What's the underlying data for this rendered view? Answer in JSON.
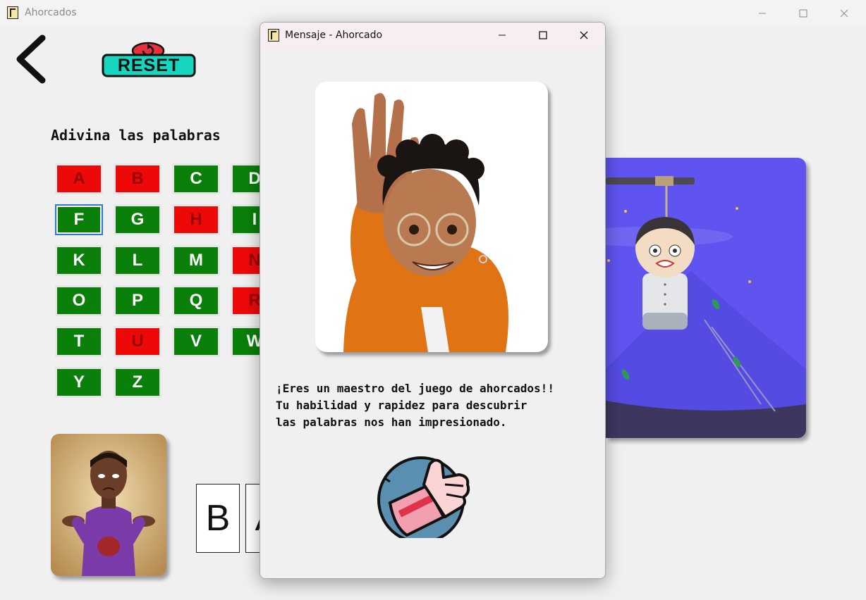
{
  "window": {
    "title": "Ahorcados",
    "icon": "hangman-app-icon",
    "controls": [
      "minimize",
      "maximize",
      "close"
    ]
  },
  "toolbar": {
    "back_icon": "chevron-left-icon",
    "reset_label": "RESET"
  },
  "game": {
    "heading": "Adivina las palabras",
    "letters": [
      {
        "char": "A",
        "status": "wrong"
      },
      {
        "char": "B",
        "status": "wrong"
      },
      {
        "char": "C",
        "status": "correct"
      },
      {
        "char": "D",
        "status": "correct"
      },
      {
        "char": "F",
        "status": "correct",
        "selected": true
      },
      {
        "char": "G",
        "status": "correct"
      },
      {
        "char": "H",
        "status": "wrong"
      },
      {
        "char": "I",
        "status": "correct"
      },
      {
        "char": "K",
        "status": "correct"
      },
      {
        "char": "L",
        "status": "correct"
      },
      {
        "char": "M",
        "status": "correct"
      },
      {
        "char": "N",
        "status": "wrong"
      },
      {
        "char": "O",
        "status": "correct"
      },
      {
        "char": "P",
        "status": "correct"
      },
      {
        "char": "Q",
        "status": "correct"
      },
      {
        "char": "R",
        "status": "wrong"
      },
      {
        "char": "T",
        "status": "correct"
      },
      {
        "char": "U",
        "status": "wrong"
      },
      {
        "char": "V",
        "status": "correct"
      },
      {
        "char": "W",
        "status": "correct"
      },
      {
        "char": "Y",
        "status": "correct"
      },
      {
        "char": "Z",
        "status": "correct"
      }
    ],
    "word_letters": [
      "B",
      "A"
    ]
  },
  "colors": {
    "correct": "#0a7f0a",
    "wrong": "#ee0909",
    "hangman_background": "#5f54ef",
    "reset_teal": "#17d6c0",
    "reset_red": "#e8303f"
  },
  "dialog": {
    "title": "Mensaje - Ahorcado",
    "message": "¡Eres un maestro del juego de ahorcados!!\nTu habilidad y rapidez para descubrir\nlas palabras nos han impresionado.",
    "avatar": "waving-avatar-image",
    "icon": "thumbs-up-icon"
  }
}
